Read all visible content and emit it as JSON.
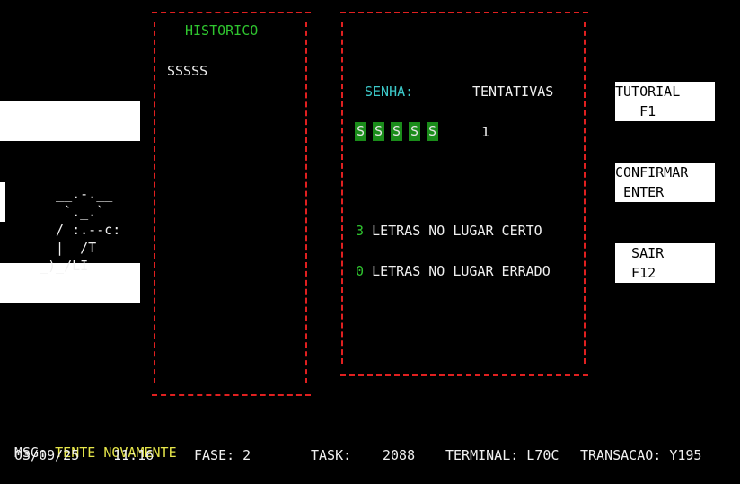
{
  "left_panel": {
    "ascii_art": [
      "  __.-.__",
      "   `._.`",
      "  / :.--c:",
      "  |  /T",
      "_)_/LI"
    ]
  },
  "history": {
    "title": "HISTORICO",
    "entries": [
      "SSSSS"
    ]
  },
  "game": {
    "senha_label": "SENHA:",
    "tentativas_label": "TENTATIVAS",
    "letters": [
      "S",
      "S",
      "S",
      "S",
      "S"
    ],
    "tentativas_value": "1",
    "correct_count": "3",
    "correct_text": "LETRAS NO LUGAR CERTO",
    "wrong_count": "0",
    "wrong_text": "LETRAS NO LUGAR ERRADO"
  },
  "buttons": {
    "tutorial_label": "TUTORIAL\n   F1",
    "confirm_label": "CONFIRMAR\n ENTER",
    "exit_label": "  SAIR\n  F12"
  },
  "status": {
    "msg_label": "MSG:",
    "msg_value": "TENTE NOVAMENTE",
    "date": "03/09/25",
    "time": "11:16",
    "fase": "FASE: 2",
    "task_label": "TASK:",
    "task_value": "2088",
    "terminal": "TERMINAL: L70C",
    "transacao": "TRANSACAO: Y195"
  },
  "colors": {
    "background": "#000000",
    "border": "#e02020",
    "green": "#2fc52f",
    "cyan": "#3cc8c8",
    "yellow": "#e6e64a",
    "cell_bg": "#1a8c1a"
  }
}
